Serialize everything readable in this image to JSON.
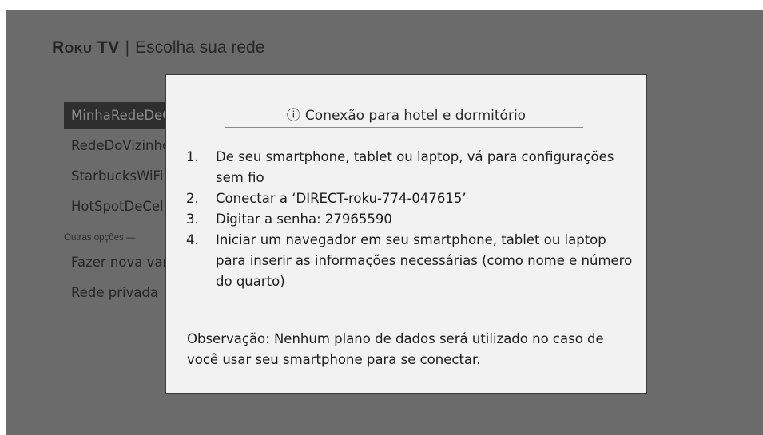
{
  "header": {
    "brand": "Roku TV",
    "separator": "|",
    "title": "Escolha sua rede"
  },
  "menu": {
    "items": [
      {
        "label": "MinhaRedeDeCasa",
        "selected": true
      },
      {
        "label": "RedeDoVizinho",
        "selected": false
      },
      {
        "label": "StarbucksWiFi",
        "selected": false
      },
      {
        "label": "HotSpotDeCelular",
        "selected": false
      }
    ],
    "group_label": "Outras opções —",
    "other_items": [
      {
        "label": "Fazer nova varredura"
      },
      {
        "label": "Rede privada"
      }
    ]
  },
  "dialog": {
    "info_icon": "ⓘ",
    "title": "Conexão para hotel e dormitório",
    "steps": [
      {
        "num": "1.",
        "text": "De seu smartphone, tablet ou laptop, vá para configurações sem fio"
      },
      {
        "num": "2.",
        "text": "Conectar a ‘DIRECT-roku-774-047615’"
      },
      {
        "num": "3.",
        "text": "Digitar a senha: 27965590"
      },
      {
        "num": "4.",
        "text": "Iniciar um navegador em seu smartphone, tablet ou laptop para inserir as informações necessárias (como nome e número do quarto)"
      }
    ],
    "note": "Observação: Nenhum plano de dados será utilizado no caso de você usar seu smartphone para se conectar."
  },
  "colors": {
    "screen_bg": "#6b6b6b",
    "dialog_bg": "#f2f2f2",
    "selected_bg": "#2e2e2e",
    "text_dark": "#1c1c1c"
  }
}
